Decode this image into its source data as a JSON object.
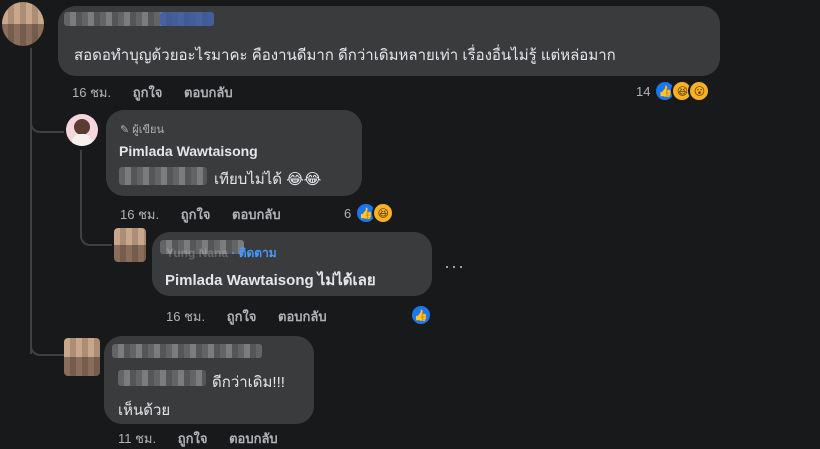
{
  "comment1": {
    "text": "สอดอทำบุญด้วยอะไรมาคะ คืองานดีมาก ดีกว่าเดิมหลายเท่า เรื่องอื่นไม่รู้ แต่หล่อมาก",
    "time": "16 ชม.",
    "like_action": "ถูกใจ",
    "reply_action": "ตอบกลับ",
    "reaction_count": "14"
  },
  "reply1": {
    "author_badge": "ผู้เขียน",
    "name": "Pimlada Wawtaisong",
    "text": "เทียบไม่ได้ 😂😂",
    "time": "16 ชม.",
    "like_action": "ถูกใจ",
    "reply_action": "ตอบกลับ",
    "reaction_count": "6"
  },
  "reply2": {
    "name_partial": "Yung Nana",
    "follow": "· ติดตาม",
    "text": "Pimlada Wawtaisong ไม่ได้เลย",
    "time": "16 ชม.",
    "like_action": "ถูกใจ",
    "reply_action": "ตอบกลับ",
    "more": "···"
  },
  "comment2": {
    "text_line1": "ดีกว่าเดิม!!!",
    "text_line2": "เห็นด้วย",
    "time": "11 ชม.",
    "like_action": "ถูกใจ",
    "reply_action": "ตอบกลับ"
  },
  "icons": {
    "like": "thumbs-up-icon",
    "haha": "laughing-emoji-icon",
    "wow": "wow-emoji-icon",
    "author": "pencil-icon",
    "more": "more-icon"
  },
  "colors": {
    "background": "#18191a",
    "bubble": "#3a3b3c",
    "like_blue": "#1877f2",
    "link": "#4599ff"
  }
}
